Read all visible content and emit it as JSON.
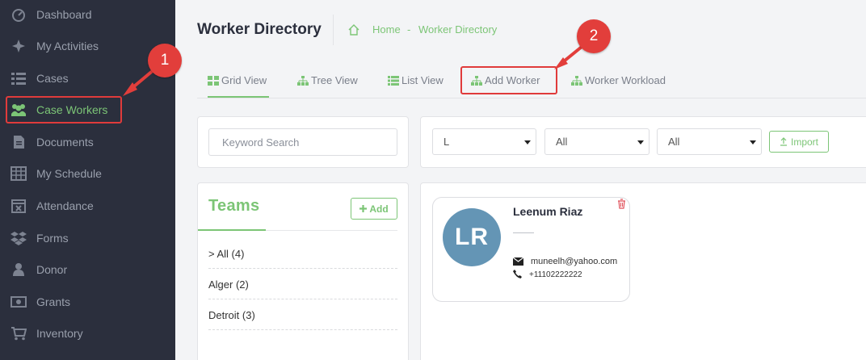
{
  "sidebar": {
    "items": [
      {
        "label": "Dashboard",
        "icon": "dashboard-icon"
      },
      {
        "label": "My Activities",
        "icon": "activities-icon"
      },
      {
        "label": "Cases",
        "icon": "list-icon"
      },
      {
        "label": "Case Workers",
        "icon": "users-icon",
        "active": true
      },
      {
        "label": "Documents",
        "icon": "document-icon"
      },
      {
        "label": "My Schedule",
        "icon": "calendar-grid-icon"
      },
      {
        "label": "Attendance",
        "icon": "calendar-x-icon"
      },
      {
        "label": "Forms",
        "icon": "dropbox-icon"
      },
      {
        "label": "Donor",
        "icon": "user-icon"
      },
      {
        "label": "Grants",
        "icon": "money-icon"
      },
      {
        "label": "Inventory",
        "icon": "cart-icon"
      }
    ]
  },
  "header": {
    "title": "Worker Directory",
    "breadcrumb": {
      "home": "Home",
      "separator": "-",
      "current": "Worker Directory"
    }
  },
  "tabs": [
    {
      "label": "Grid View",
      "icon": "grid-icon",
      "active": true
    },
    {
      "label": "Tree View",
      "icon": "sitemap-icon"
    },
    {
      "label": "List View",
      "icon": "list-icon"
    },
    {
      "label": "Add Worker",
      "icon": "sitemap-icon"
    },
    {
      "label": "Worker Workload",
      "icon": "sitemap-icon"
    }
  ],
  "search": {
    "placeholder": "Keyword Search",
    "value": ""
  },
  "filters": {
    "letter": "L",
    "filter2": "All",
    "filter3": "All",
    "import_label": "Import"
  },
  "teams": {
    "title": "Teams",
    "add_label": "Add",
    "rows": [
      {
        "label": "> All (4)"
      },
      {
        "label": "Alger (2)"
      },
      {
        "label": "Detroit (3)"
      }
    ]
  },
  "worker": {
    "initials": "LR",
    "name": "Leenum Riaz",
    "email": "muneelh@yahoo.com",
    "phone": "+11102222222"
  },
  "annotations": {
    "callout_1": "1",
    "callout_2": "2"
  },
  "colors": {
    "sidebar_bg": "#2b2f3d",
    "accent": "#7cc576",
    "avatar_bg": "#6495b5",
    "callout": "#e23e3b",
    "danger": "#e0505a"
  }
}
